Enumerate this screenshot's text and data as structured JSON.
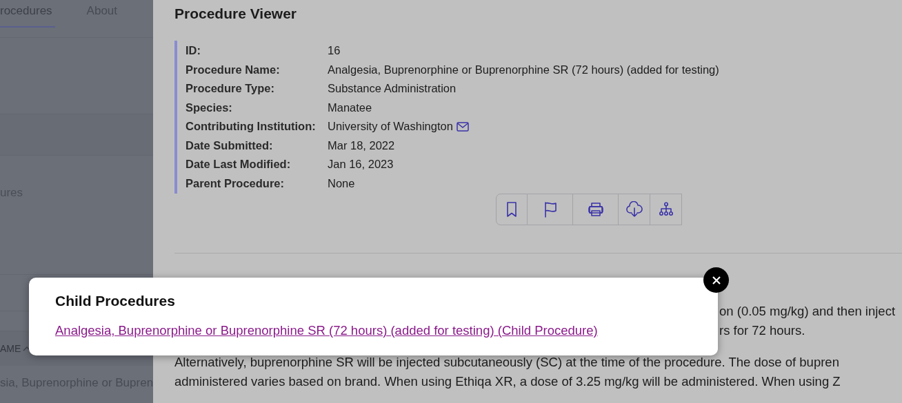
{
  "sidebar": {
    "tabs": [
      {
        "label": "rocedures",
        "selected": true
      },
      {
        "label": "About",
        "selected": false
      }
    ],
    "section_label": "ures",
    "table": {
      "column_header": {
        "label": "AME",
        "sort_ascending": true
      },
      "rows": [
        "sia, Buprenorphine or Bupren"
      ]
    }
  },
  "main": {
    "title": "Procedure Viewer",
    "details": [
      {
        "label": "ID:",
        "value": "16",
        "email": false
      },
      {
        "label": "Procedure Name:",
        "value": "Analgesia, Buprenorphine or Buprenorphine SR (72 hours) (added for testing)",
        "email": false
      },
      {
        "label": "Procedure Type:",
        "value": "Substance Administration",
        "email": false
      },
      {
        "label": "Species:",
        "value": "Manatee",
        "email": false
      },
      {
        "label": "Contributing Institution:",
        "value": "University of Washington",
        "email": true
      },
      {
        "label": "Date Submitted:",
        "value": "Mar 18, 2022",
        "email": false
      },
      {
        "label": "Date Last Modified:",
        "value": "Jan 16, 2023",
        "email": false
      },
      {
        "label": "Parent Procedure:",
        "value": "None",
        "email": false
      }
    ],
    "toolbar": [
      {
        "kind": "bookmark"
      },
      {
        "kind": "flag"
      },
      {
        "kind": "print"
      },
      {
        "kind": "download"
      },
      {
        "kind": "hierarchy"
      }
    ],
    "paragraphs": [
      {
        "kind": "obscured",
        "lines": [
          "on (0.05 mg/kg) and then inject",
          "rs for 72 hours."
        ]
      },
      {
        "kind": "full",
        "lines": [
          "Alternatively, buprenorphine SR will be injected subcutaneously (SC) at the time of the procedure. The dose of bupren",
          "administered varies based on brand. When using Ethiqa XR, a dose of 3.25 mg/kg will be administered. When using Z"
        ]
      }
    ]
  },
  "modal": {
    "title": "Child Procedures",
    "links": [
      "Analgesia, Buprenorphine or Buprenorphine SR (72 hours) (added for testing) (Child Procedure)"
    ]
  }
}
